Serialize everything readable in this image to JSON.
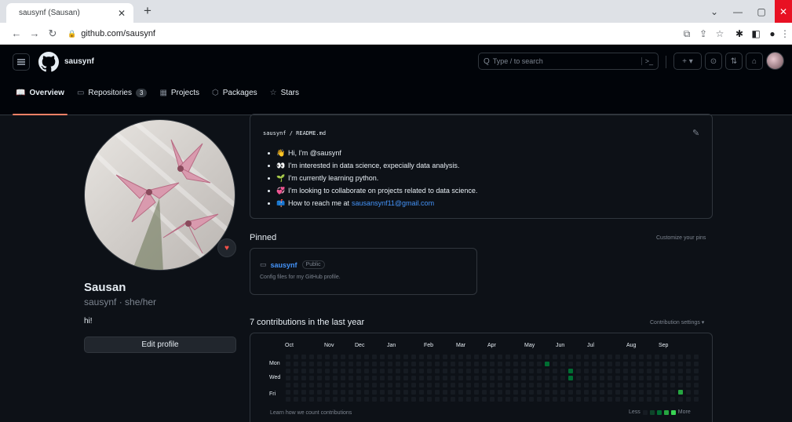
{
  "browser": {
    "tab_title": "sausynf (Sausan)",
    "url": "github.com/sausynf"
  },
  "header": {
    "username": "sausynf",
    "search_placeholder": "Type / to search",
    "search_prefix": "Q",
    "search_cmd": ">_",
    "new_button": "+ ▾"
  },
  "nav": {
    "overview": "Overview",
    "repositories": "Repositories",
    "repositories_count": "3",
    "projects": "Projects",
    "packages": "Packages",
    "stars": "Stars"
  },
  "profile": {
    "name": "Sausan",
    "login": "sausynf · she/her",
    "bio": "hi!",
    "edit_button": "Edit profile"
  },
  "readme": {
    "path": "sausynf / README.md",
    "items": [
      {
        "emoji": "👋",
        "text": "Hi, I'm @sausynf"
      },
      {
        "emoji": "👀",
        "text": "I'm interested in data science, expecially data analysis."
      },
      {
        "emoji": "🌱",
        "text": "I'm currently learning python."
      },
      {
        "emoji": "💞️",
        "text": "I'm looking to collaborate on projects related to data science."
      },
      {
        "emoji": "📫",
        "text": "How to reach me at",
        "link": "sausansynf11@gmail.com"
      }
    ]
  },
  "pinned": {
    "title": "Pinned",
    "customize": "Customize your pins",
    "repo_name": "sausynf",
    "repo_badge": "Public",
    "repo_desc": "Config files for my GitHub profile."
  },
  "contributions": {
    "title": "7 contributions in the last year",
    "settings": "Contribution settings ▾",
    "months": [
      "Oct",
      "Nov",
      "Dec",
      "Jan",
      "Feb",
      "Mar",
      "Apr",
      "May",
      "Jun",
      "Jul",
      "Aug",
      "Sep"
    ],
    "days": [
      "Mon",
      "Wed",
      "Fri"
    ],
    "learn": "Learn how we count contributions",
    "less": "Less",
    "more": "More",
    "active_cells": [
      {
        "week": 33,
        "day": 1,
        "level": 2
      },
      {
        "week": 36,
        "day": 2,
        "level": 2
      },
      {
        "week": 36,
        "day": 3,
        "level": 2
      },
      {
        "week": 50,
        "day": 5,
        "level": 3
      }
    ],
    "colors": {
      "empty": "#161b22",
      "l1": "#0e4429",
      "l2": "#006d32",
      "l3": "#26a641",
      "l4": "#39d353"
    }
  }
}
